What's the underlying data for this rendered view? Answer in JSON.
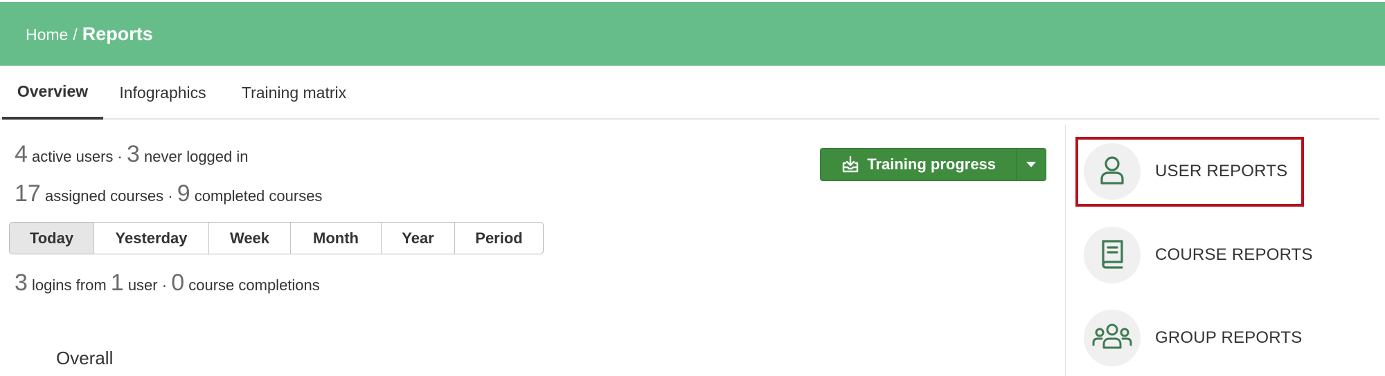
{
  "breadcrumb": {
    "home": "Home",
    "separator": "/",
    "current": "Reports"
  },
  "tabs": [
    {
      "label": "Overview",
      "active": true
    },
    {
      "label": "Infographics",
      "active": false
    },
    {
      "label": "Training matrix",
      "active": false
    }
  ],
  "stats": {
    "active_users": "4",
    "active_users_label": "active users ·",
    "never_logged_in": "3",
    "never_logged_in_label": "never logged in",
    "assigned_courses": "17",
    "assigned_courses_label": "assigned courses ·",
    "completed_courses": "9",
    "completed_courses_label": "completed courses"
  },
  "periods": [
    {
      "label": "Today",
      "active": true
    },
    {
      "label": "Yesterday",
      "active": false
    },
    {
      "label": "Week",
      "active": false
    },
    {
      "label": "Month",
      "active": false
    },
    {
      "label": "Year",
      "active": false
    },
    {
      "label": "Period",
      "active": false
    }
  ],
  "activity": {
    "logins": "3",
    "logins_label": "logins from",
    "users": "1",
    "users_label": "user ·",
    "completions": "0",
    "completions_label": "course completions"
  },
  "overall_heading": "Overall",
  "training_progress_button": {
    "label": "Training progress",
    "icon": "download-icon",
    "dropdown_icon": "caret-down-icon"
  },
  "reports": [
    {
      "label": "USER REPORTS",
      "icon": "user-icon",
      "highlighted": true
    },
    {
      "label": "COURSE REPORTS",
      "icon": "book-icon",
      "highlighted": false
    },
    {
      "label": "GROUP REPORTS",
      "icon": "group-icon",
      "highlighted": false
    }
  ],
  "colors": {
    "header": "#66bd8a",
    "button": "#3f8c3f",
    "icon": "#3f7a52",
    "highlight": "#b5121b"
  }
}
